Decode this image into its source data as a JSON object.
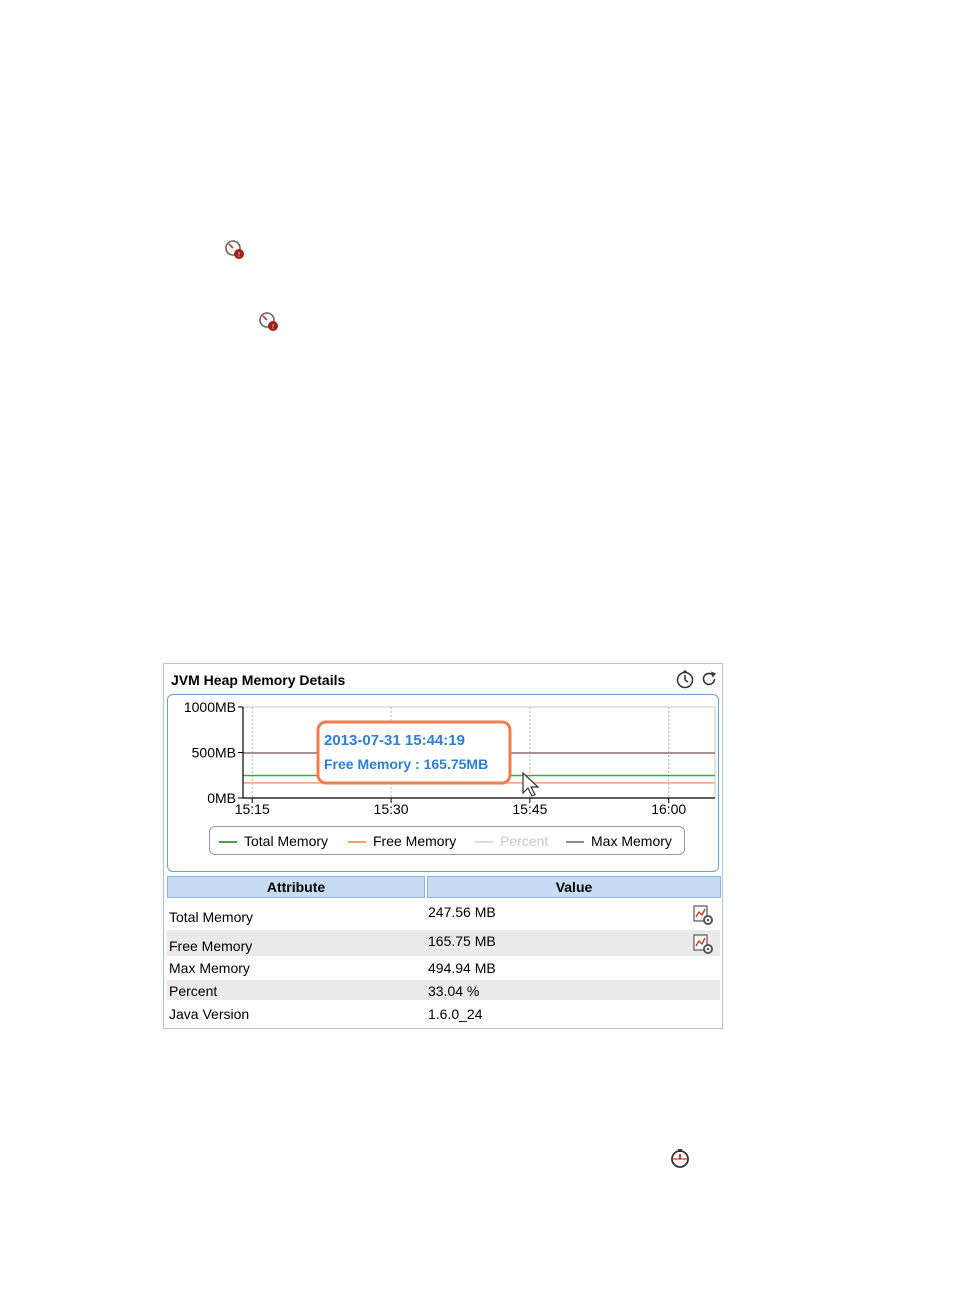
{
  "page_icons": [
    {
      "name": "gauge-red-icon"
    },
    {
      "name": "gauge-red-icon-2"
    },
    {
      "name": "timer-icon"
    }
  ],
  "widget": {
    "title": "JVM Heap Memory Details",
    "title_buttons": [
      {
        "name": "timer-icon",
        "label": "Set time range"
      },
      {
        "name": "refresh-icon",
        "label": "Refresh"
      }
    ],
    "tooltip": {
      "timestamp": "2013-07-31 15:44:19",
      "text": "Free Memory : 165.75MB"
    },
    "legend": [
      {
        "label": "Total Memory",
        "color": "#4aa34a"
      },
      {
        "label": "Free Memory",
        "color": "#f4a06c"
      },
      {
        "label": "Percent",
        "color": "#dcdcdc"
      },
      {
        "label": "Max Memory",
        "color": "#8a8a8a"
      }
    ],
    "table": {
      "headers": [
        "Attribute",
        "Value"
      ],
      "rows": [
        {
          "attribute": "Total Memory",
          "value": "247.56 MB",
          "has_icon": true
        },
        {
          "attribute": "Free Memory",
          "value": "165.75 MB",
          "has_icon": true
        },
        {
          "attribute": "Max Memory",
          "value": "494.94 MB",
          "has_icon": false
        },
        {
          "attribute": "Percent",
          "value": "33.04 %",
          "has_icon": false
        },
        {
          "attribute": "Java Version",
          "value": "1.6.0_24",
          "has_icon": false
        }
      ]
    }
  },
  "chart_data": {
    "type": "line",
    "title": "",
    "x_ticks": [
      "15:15",
      "15:30",
      "15:45",
      "16:00"
    ],
    "y_ticks": [
      "0MB",
      "500MB",
      "1000MB"
    ],
    "ylim": [
      0,
      1000
    ],
    "xlim": [
      "15:14",
      "16:05"
    ],
    "grid": true,
    "legend_position": "bottom",
    "series": [
      {
        "name": "Total Memory",
        "color": "#4aa34a",
        "x": [
          "15:14",
          "16:05"
        ],
        "values": [
          247.56,
          247.56
        ]
      },
      {
        "name": "Free Memory",
        "color": "#f4a06c",
        "x": [
          "15:14",
          "16:05"
        ],
        "values": [
          165.75,
          165.75
        ]
      },
      {
        "name": "Percent",
        "color": "#dcdcdc",
        "x": [],
        "values": []
      },
      {
        "name": "Max Memory",
        "color": "#8a6a7a",
        "x": [
          "15:14",
          "16:05"
        ],
        "values": [
          494.94,
          494.94
        ]
      }
    ]
  }
}
